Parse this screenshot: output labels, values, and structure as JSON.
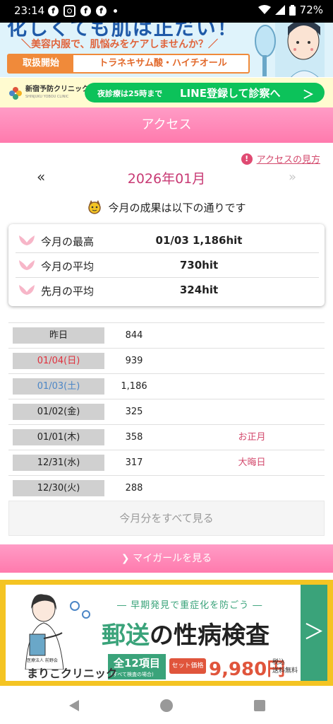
{
  "status_bar": {
    "time": "23:14",
    "app_icons": [
      "facebook-icon",
      "instagram-icon",
      "facebook-icon",
      "facebook-icon"
    ],
    "battery": "72%"
  },
  "ad_top": {
    "headline": "化しくても肌は正だい！",
    "tagline": "＼美容内服で、肌悩みをケアしませんか？／",
    "badge": "取扱開始",
    "ingredients": "トラネキサム酸・ハイチオール"
  },
  "clinic_bar": {
    "clinic_name": "新宿予防クリニック",
    "clinic_sub": "SHINJUKU YOBOU CLINIC",
    "night_hours": "夜診療は25時まで",
    "line_cta": "LINE登録して診察へ",
    "arrow": "＞"
  },
  "header": {
    "title": "アクセス"
  },
  "howto": {
    "icon": "!",
    "label": "アクセスの見方"
  },
  "month_nav": {
    "prev": "«",
    "next": "»",
    "title": "2026年01月"
  },
  "result_text": "今月の成果は以下の通りです",
  "summary": [
    {
      "label": "今月の最高",
      "value": "01/03 1,186hit"
    },
    {
      "label": "今月の平均",
      "value": "730hit"
    },
    {
      "label": "先月の平均",
      "value": "324hit"
    }
  ],
  "daily": [
    {
      "date": "昨日",
      "hits": "844",
      "note": "",
      "color": "normal"
    },
    {
      "date": "01/04(日)",
      "hits": "939",
      "note": "",
      "color": "red"
    },
    {
      "date": "01/03(土)",
      "hits": "1,186",
      "note": "",
      "color": "blue"
    },
    {
      "date": "01/02(金)",
      "hits": "325",
      "note": "",
      "color": "normal"
    },
    {
      "date": "01/01(木)",
      "hits": "358",
      "note": "お正月",
      "color": "normal"
    },
    {
      "date": "12/31(水)",
      "hits": "317",
      "note": "大晦日",
      "color": "normal"
    },
    {
      "date": "12/30(火)",
      "hits": "288",
      "note": "",
      "color": "normal"
    }
  ],
  "see_all": "今月分をすべて見る",
  "my_girl": "マイガールを見る",
  "ad_bottom": {
    "sub": "― 早期発見で重症化を防ごう ―",
    "main_a": "郵送",
    "main_b": "の性病検査",
    "items_a": "全12項目",
    "items_b": "(すべて検査の場合)",
    "set_label": "セット価格",
    "price": "9,980円",
    "tax_a": "税込",
    "tax_b": "送料無料",
    "clinic_sub": "医療法人 前野会",
    "clinic": "まりこクリニック",
    "arrow": "＞"
  },
  "colors": {
    "header_pink": "#ff85b5",
    "month_title": "#c83a74",
    "line_green": "#0cc25a",
    "sunday_red": "#e0303c",
    "saturday_blue": "#4c86c6"
  }
}
